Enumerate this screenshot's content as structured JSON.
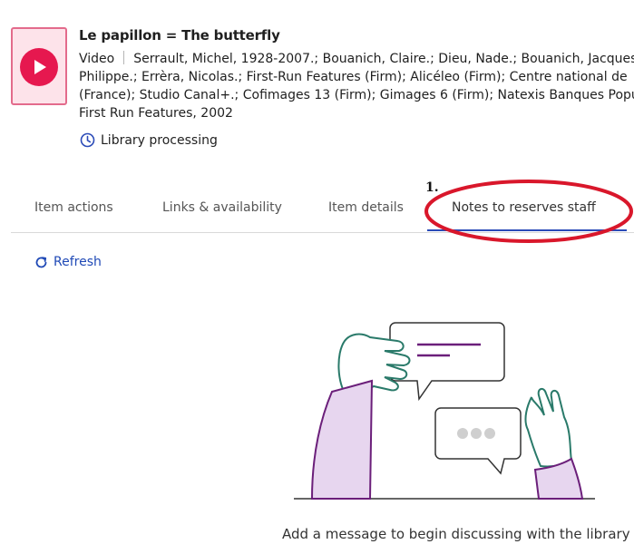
{
  "item": {
    "title": "Le papillon = The butterfly",
    "type": "Video",
    "contributors_line1": "Serrault, Michel, 1928-2007.; Bouanich, Claire.; Dieu, Nade.; Bouanich, Jacques",
    "contributors_line2": "Philippe.; Errèra, Nicolas.; First-Run Features (Firm); Alicéleo (Firm); Centre national de",
    "contributors_line3": "(France); Studio Canal+.; Cofimages 13 (Firm); Gimages 6 (Firm); Natexis Banques Popu",
    "publisher": "First Run Features, 2002",
    "status": "Library processing"
  },
  "tabs": [
    {
      "label": "Item actions"
    },
    {
      "label": "Links & availability"
    },
    {
      "label": "Item details"
    },
    {
      "label": "Notes to reserves staff"
    }
  ],
  "annotation": {
    "number": "1."
  },
  "refresh_label": "Refresh",
  "empty_message": "Add a message to begin discussing with the library",
  "colors": {
    "accent": "#2b4bb8",
    "play": "#e6184f",
    "annotation": "#d9172b",
    "illustration_purple": "#6b1f7a",
    "illustration_green": "#2a7a6a"
  }
}
